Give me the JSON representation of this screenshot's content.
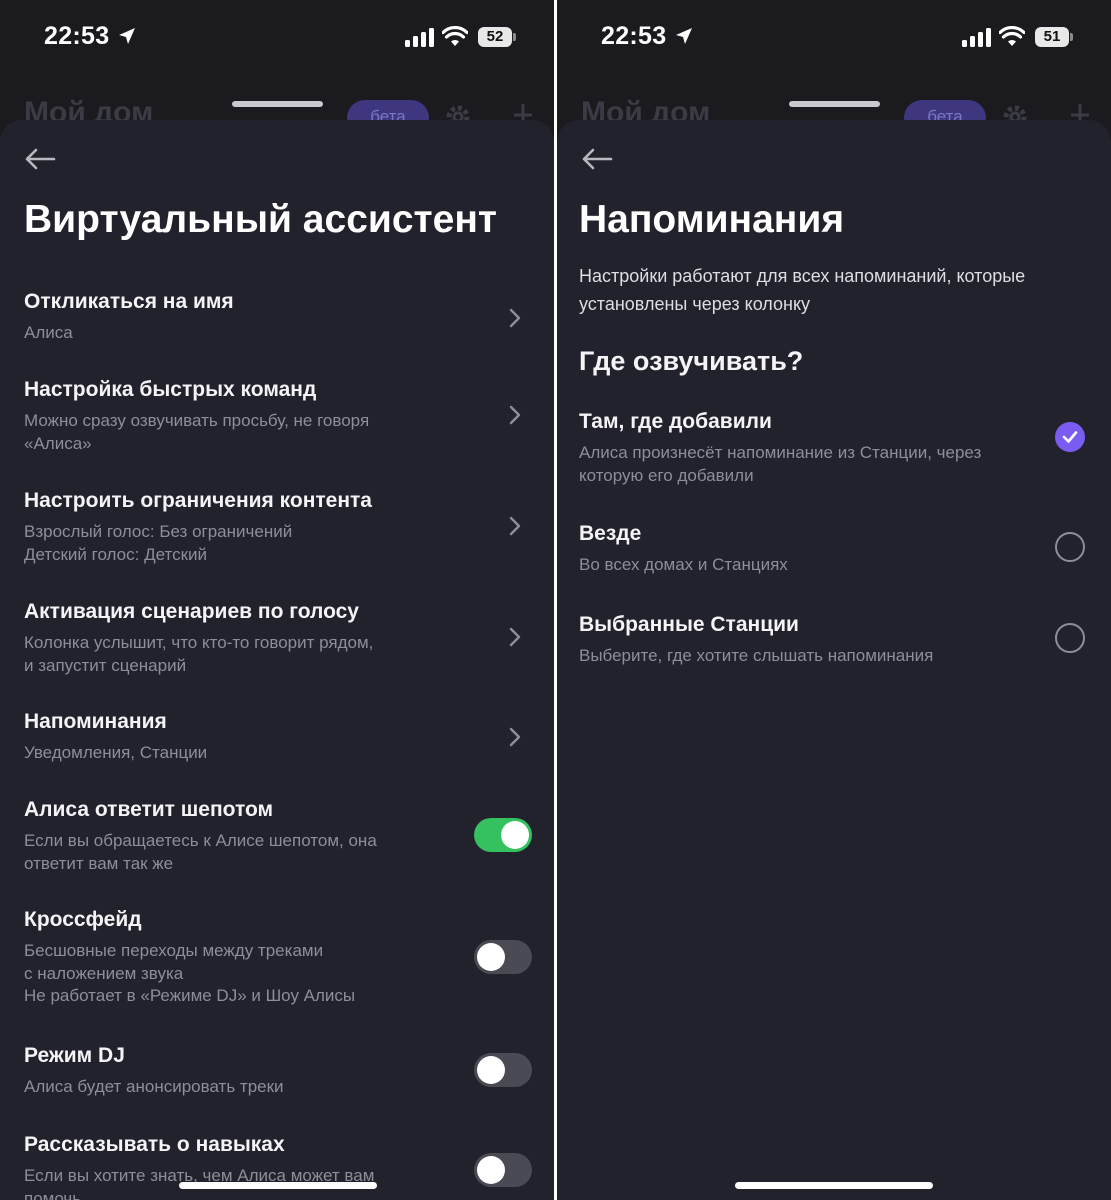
{
  "left": {
    "status": {
      "time": "22:53",
      "battery": "52"
    },
    "background_page": {
      "title": "Мой дом",
      "badge": "бета"
    },
    "title": "Виртуальный ассистент",
    "items": [
      {
        "title": "Откликаться на имя",
        "subtitle": "Алиса"
      },
      {
        "title": "Настройка быстрых команд",
        "subtitle_lines": [
          "Можно сразу озвучивать просьбу, не говоря",
          "«Алиса»"
        ]
      },
      {
        "title": "Настроить ограничения контента",
        "subtitle_lines": [
          "Взрослый голос: Без ограничений",
          "Детский голос: Детский"
        ]
      },
      {
        "title": "Активация сценариев по голосу",
        "subtitle_lines": [
          "Колонка услышит, что кто-то говорит рядом,",
          "и запустит сценарий"
        ]
      },
      {
        "title": "Напоминания",
        "subtitle": "Уведомления, Станции"
      }
    ],
    "toggles": [
      {
        "title": "Алиса ответит шепотом",
        "subtitle_lines": [
          "Если вы обращаетесь к Алисе шепотом, она",
          "ответит вам так же"
        ],
        "on": true
      },
      {
        "title": "Кроссфейд",
        "subtitle_lines": [
          "Бесшовные переходы между треками",
          "с наложением звука",
          "Не работает в «Режиме DJ» и Шоу Алисы"
        ],
        "on": false
      },
      {
        "title": "Режим DJ",
        "subtitle": "Алиса будет анонсировать треки",
        "on": false
      },
      {
        "title": "Рассказывать о навыках",
        "subtitle_lines": [
          "Если вы хотите знать, чем Алиса может вам",
          "помочь"
        ],
        "on": false
      }
    ]
  },
  "right": {
    "status": {
      "time": "22:53",
      "battery": "51"
    },
    "background_page": {
      "title": "Мой дом",
      "badge": "бета"
    },
    "title": "Напоминания",
    "intro": "Настройки работают для всех напоминаний, которые установлены через колонку",
    "section_title": "Где озвучивать?",
    "options": [
      {
        "title": "Там, где добавили",
        "subtitle": "Алиса произнесёт напоминание из Станции, через которую его добавили",
        "selected": true
      },
      {
        "title": "Везде",
        "subtitle": "Во всех домах и Станциях",
        "selected": false
      },
      {
        "title": "Выбранные Станции",
        "subtitle": "Выберите, где хотите слышать напоминания",
        "selected": false
      }
    ]
  },
  "colors": {
    "accent": "#7b5cf0",
    "toggle_on": "#35c160",
    "sheet_bg": "#22222c",
    "secondary_text": "#8e8e98"
  }
}
